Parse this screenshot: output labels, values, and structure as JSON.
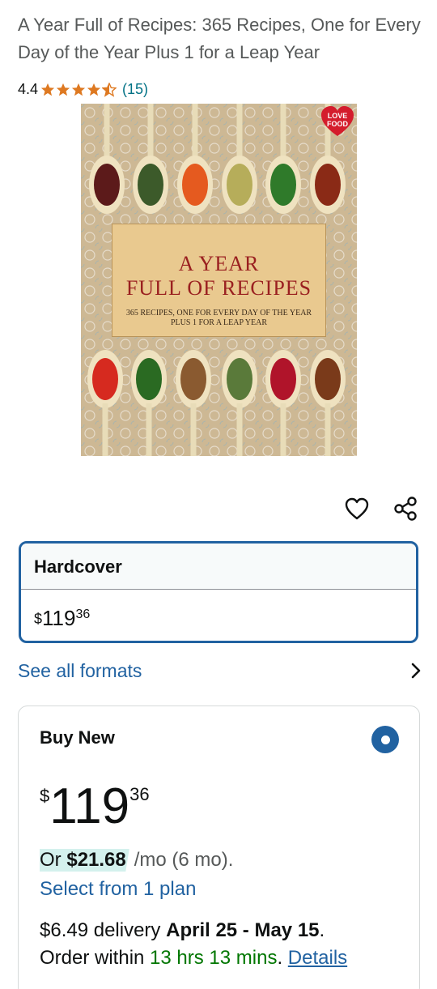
{
  "product": {
    "title": "A Year Full of Recipes: 365 Recipes, One for Every Day of the Year Plus 1 for a Leap Year",
    "rating_value": "4.4",
    "rating_stars": 4.4,
    "rating_count": "(15)"
  },
  "cover": {
    "title_line1": "A YEAR",
    "title_line2": "FULL OF RECIPES",
    "subtitle_line1": "365 RECIPES, ONE FOR EVERY DAY OF THE YEAR",
    "subtitle_line2": "PLUS 1 FOR A LEAP YEAR",
    "badge": "LOVE FOOD"
  },
  "actions": {
    "wishlist_icon": "heart-icon",
    "share_icon": "share-icon"
  },
  "format": {
    "label": "Hardcover",
    "price_symbol": "$",
    "price_whole": "119",
    "price_fraction": "36"
  },
  "see_all_formats": {
    "label": "See all formats",
    "icon": "chevron-right-icon"
  },
  "buy_new": {
    "title": "Buy New",
    "price_symbol": "$",
    "price_whole": "119",
    "price_fraction": "36",
    "plan_prefix": "Or",
    "plan_amount": "$21.68",
    "plan_suffix": "/mo (6 mo).",
    "plan_link": "Select from 1 plan",
    "delivery_fee": "$6.49 delivery",
    "delivery_dates": "April 25 - May 15",
    "delivery_period": ".",
    "order_within_prefix": "Order within",
    "order_within_time": "13 hrs 13 mins",
    "order_within_period": ".",
    "details_link": "Details"
  },
  "colors": {
    "link": "#2162a1",
    "teal_link": "#007185",
    "star": "#de7921",
    "green": "#007600",
    "radio": "#2162a1",
    "plan_highlight": "#d4f1ed"
  }
}
